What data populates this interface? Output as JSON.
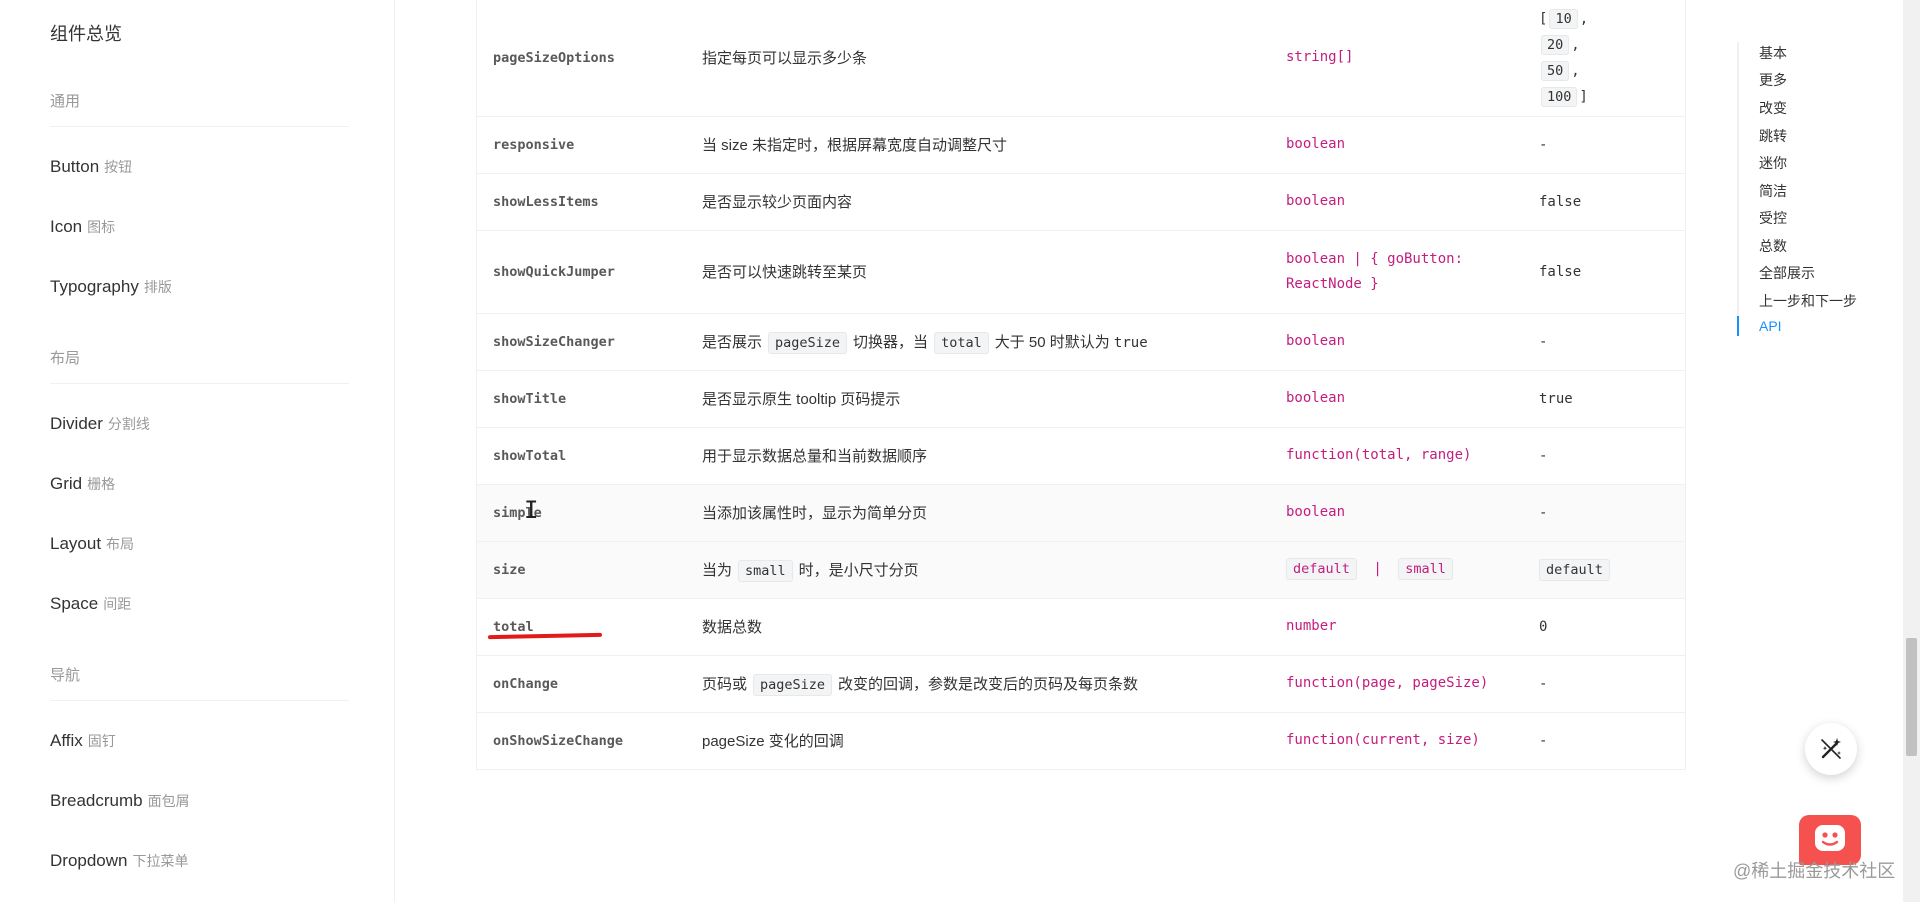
{
  "sidebar": {
    "title": "组件总览",
    "groups": {
      "general": "通用",
      "layout": "布局",
      "navigation": "导航"
    },
    "items": [
      {
        "en": "Button",
        "cn": "按钮"
      },
      {
        "en": "Icon",
        "cn": "图标"
      },
      {
        "en": "Typography",
        "cn": "排版"
      },
      {
        "en": "Divider",
        "cn": "分割线"
      },
      {
        "en": "Grid",
        "cn": "栅格"
      },
      {
        "en": "Layout",
        "cn": "布局"
      },
      {
        "en": "Space",
        "cn": "间距"
      },
      {
        "en": "Affix",
        "cn": "固钉"
      },
      {
        "en": "Breadcrumb",
        "cn": "面包屑"
      },
      {
        "en": "Dropdown",
        "cn": "下拉菜单"
      }
    ]
  },
  "table": {
    "rows": [
      {
        "prop": "pageSizeOptions",
        "desc": "指定每页可以显示多少条",
        "type": "string[]",
        "options": [
          "10",
          "20",
          "50",
          "100"
        ],
        "open": "[",
        "close": "]",
        "comma": ","
      },
      {
        "prop": "responsive",
        "desc": "当 size 未指定时，根据屏幕宽度自动调整尺寸",
        "type": "boolean",
        "def": "-"
      },
      {
        "prop": "showLessItems",
        "desc": "是否显示较少页面内容",
        "type": "boolean",
        "def": "false"
      },
      {
        "prop": "showQuickJumper",
        "desc": "是否可以快速跳转至某页",
        "type": "boolean | { goButton: ReactNode }",
        "def": "false"
      },
      {
        "prop": "showSizeChanger",
        "desc_a": "是否展示",
        "desc_code1": "pageSize",
        "desc_b": "切换器，当",
        "desc_code2": "total",
        "desc_c": "大于 50 时默认为",
        "desc_tail": "true",
        "type": "boolean",
        "def": "-"
      },
      {
        "prop": "showTitle",
        "desc": "是否显示原生 tooltip 页码提示",
        "type": "boolean",
        "def": "true"
      },
      {
        "prop": "showTotal",
        "desc": "用于显示数据总量和当前数据顺序",
        "type": "function(total, range)",
        "def": "-"
      },
      {
        "prop": "simple",
        "desc": "当添加该属性时，显示为简单分页",
        "type": "boolean",
        "def": "-"
      },
      {
        "prop": "size",
        "desc_a": "当为",
        "desc_code1": "small",
        "desc_b": "时，是小尺寸分页",
        "type_code1": "default",
        "type_sep": "|",
        "type_code2": "small",
        "def_code": "default"
      },
      {
        "prop": "total",
        "desc": "数据总数",
        "type": "number",
        "def": "0"
      },
      {
        "prop": "onChange",
        "desc_a": "页码或",
        "desc_code1": "pageSize",
        "desc_b": "改变的回调，参数是改变后的页码及每页条数",
        "type": "function(page, pageSize)",
        "def": "-"
      },
      {
        "prop": "onShowSizeChange",
        "desc": "pageSize 变化的回调",
        "type": "function(current, size)",
        "def": "-"
      }
    ]
  },
  "anchor": {
    "items": [
      "基本",
      "更多",
      "改变",
      "跳转",
      "迷你",
      "简洁",
      "受控",
      "总数",
      "全部展示",
      "上一步和下一步",
      "API"
    ],
    "active": "API"
  },
  "watermark": "@稀土掘金技术社区",
  "colors": {
    "accent": "#1890ff",
    "type_text": "#c41d7f",
    "annotation_red": "#e21a1a",
    "bot_red": "#f5524f"
  },
  "icons": {
    "fab": "magic-wand-icon",
    "bot": "chat-bot-icon"
  }
}
